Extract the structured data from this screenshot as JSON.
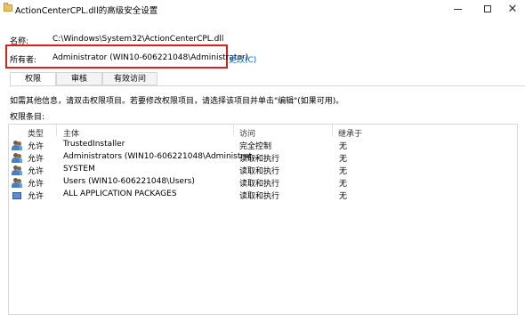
{
  "window": {
    "title": "ActionCenterCPL.dll的高级安全设置",
    "minimize_glyph": "—",
    "maximize_glyph": "☐",
    "close_glyph": "✕"
  },
  "name_row": {
    "label": "名称:",
    "value": "C:\\Windows\\System32\\ActionCenterCPL.dll"
  },
  "owner_row": {
    "label": "所有者:",
    "value": "Administrator (WIN10-606221048\\Administrator)",
    "change_link": "更改(C)"
  },
  "tabs": [
    {
      "label": "权限",
      "active": true
    },
    {
      "label": "审核",
      "active": false
    },
    {
      "label": "有效访问",
      "active": false
    }
  ],
  "info_text": "如需其他信息，请双击权限项目。若要修改权限项目，请选择该项目并单击\"编辑\"(如果可用)。",
  "entries_label": "权限条目:",
  "table": {
    "headers": {
      "type": "类型",
      "principal": "主体",
      "access": "访问",
      "inherit": "继承于"
    },
    "rows": [
      {
        "icon": "users-icon",
        "type": "允许",
        "principal": "TrustedInstaller",
        "access": "完全控制",
        "inherit": "无"
      },
      {
        "icon": "users-icon",
        "type": "允许",
        "principal": "Administrators (WIN10-606221048\\Administrat...",
        "access": "读取和执行",
        "inherit": "无"
      },
      {
        "icon": "users-icon",
        "type": "允许",
        "principal": "SYSTEM",
        "access": "读取和执行",
        "inherit": "无"
      },
      {
        "icon": "users-icon",
        "type": "允许",
        "principal": "Users (WIN10-606221048\\Users)",
        "access": "读取和执行",
        "inherit": "无"
      },
      {
        "icon": "package-icon",
        "type": "允许",
        "principal": "ALL APPLICATION PACKAGES",
        "access": "读取和执行",
        "inherit": "无"
      }
    ]
  },
  "colors": {
    "highlight_border": "#d22323",
    "link": "#0066cc"
  }
}
